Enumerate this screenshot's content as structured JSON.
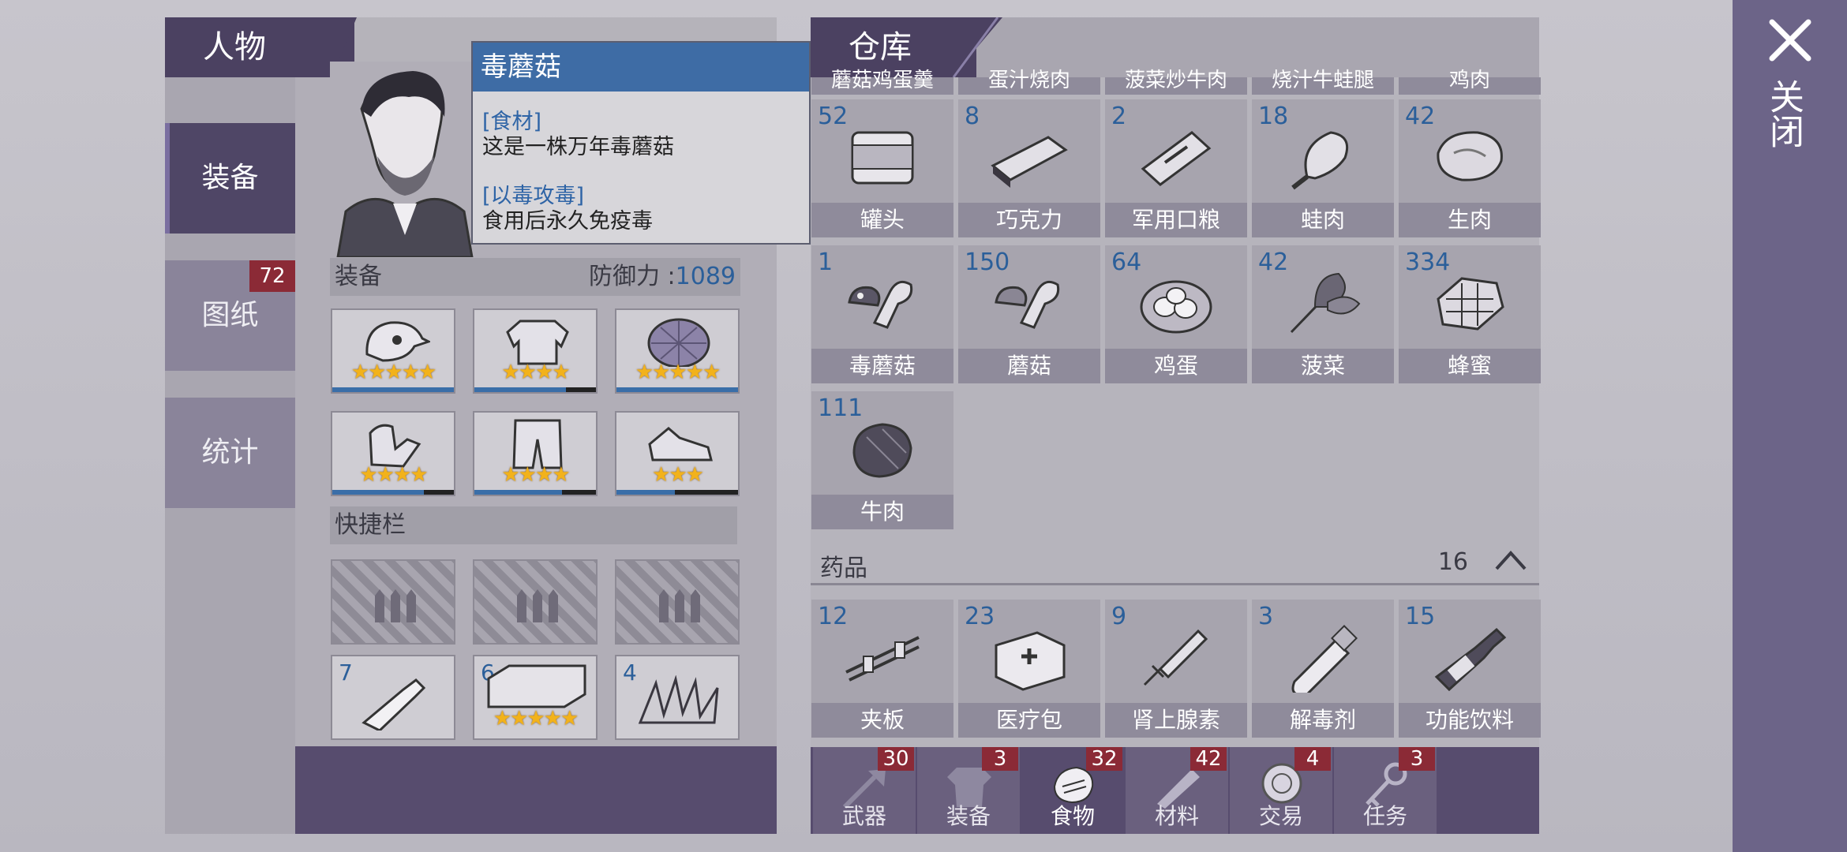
{
  "character_panel": {
    "title": "人物",
    "side_tabs": [
      {
        "label": "装备",
        "active": true
      },
      {
        "label": "图纸",
        "badge": "72"
      },
      {
        "label": "统计"
      }
    ],
    "equipment": {
      "section_label": "装备",
      "defense_label": "防御力 :",
      "defense_value": "1089",
      "slots": [
        {
          "icon": "helmet-icon",
          "stars": "★★★★★",
          "durability": 1.0
        },
        {
          "icon": "armor-icon",
          "stars": "★★★★",
          "durability": 0.75
        },
        {
          "icon": "turtle-shell-icon",
          "stars": "★★★★★",
          "durability": 1.0
        },
        {
          "icon": "gloves-icon",
          "stars": "★★★★",
          "durability": 0.75
        },
        {
          "icon": "pants-icon",
          "stars": "★★★★",
          "durability": 0.72
        },
        {
          "icon": "shoes-icon",
          "stars": "★★★",
          "durability": 0.48
        }
      ]
    },
    "quickbar": {
      "section_label": "快捷栏",
      "items": [
        {
          "count": "7",
          "icon": "bottle-icon"
        },
        {
          "count": "6",
          "icon": "brick-icon",
          "stars": "★★★★★"
        },
        {
          "count": "4",
          "icon": "thorns-icon"
        }
      ]
    }
  },
  "tooltip": {
    "title": "毒蘑菇",
    "tag1": "[食材]",
    "text1": "这是一株万年毒蘑菇",
    "tag2": "[以毒攻毒]",
    "text2": "食用后永久免疫毒"
  },
  "warehouse": {
    "title": "仓库",
    "cut_row_labels": [
      "蘑菇鸡蛋羹",
      "蛋汁烧肉",
      "菠菜炒牛肉",
      "烧汁牛蛙腿",
      "鸡肉"
    ],
    "food_items": [
      {
        "count": "52",
        "name": "罐头",
        "icon": "can-icon"
      },
      {
        "count": "8",
        "name": "巧克力",
        "icon": "chocolate-icon"
      },
      {
        "count": "2",
        "name": "军用口粮",
        "icon": "ration-icon"
      },
      {
        "count": "18",
        "name": "蛙肉",
        "icon": "frog-meat-icon"
      },
      {
        "count": "42",
        "name": "生肉",
        "icon": "raw-meat-icon"
      },
      {
        "count": "1",
        "name": "毒蘑菇",
        "icon": "poison-mushroom-icon"
      },
      {
        "count": "150",
        "name": "蘑菇",
        "icon": "mushroom-icon"
      },
      {
        "count": "64",
        "name": "鸡蛋",
        "icon": "egg-icon"
      },
      {
        "count": "42",
        "name": "菠菜",
        "icon": "spinach-icon"
      },
      {
        "count": "334",
        "name": "蜂蜜",
        "icon": "honeycomb-icon"
      },
      {
        "count": "111",
        "name": "牛肉",
        "icon": "beef-icon"
      }
    ],
    "medicine": {
      "label": "药品",
      "count": "16",
      "items": [
        {
          "count": "12",
          "name": "夹板",
          "icon": "splint-icon"
        },
        {
          "count": "23",
          "name": "医疗包",
          "icon": "medkit-icon"
        },
        {
          "count": "9",
          "name": "肾上腺素",
          "icon": "syringe-icon"
        },
        {
          "count": "3",
          "name": "解毒剂",
          "icon": "antidote-icon"
        },
        {
          "count": "15",
          "name": "功能饮料",
          "icon": "drink-icon"
        }
      ]
    },
    "categories": [
      {
        "label": "武器",
        "badge": "30",
        "icon": "axe-icon"
      },
      {
        "label": "装备",
        "badge": "3",
        "icon": "shirt-icon"
      },
      {
        "label": "食物",
        "badge": "32",
        "icon": "meat-icon",
        "active": true
      },
      {
        "label": "材料",
        "badge": "42",
        "icon": "material-icon"
      },
      {
        "label": "交易",
        "badge": "4",
        "icon": "coin-icon"
      },
      {
        "label": "任务",
        "badge": "3",
        "icon": "key-icon"
      }
    ]
  },
  "close": {
    "label": "关闭"
  }
}
